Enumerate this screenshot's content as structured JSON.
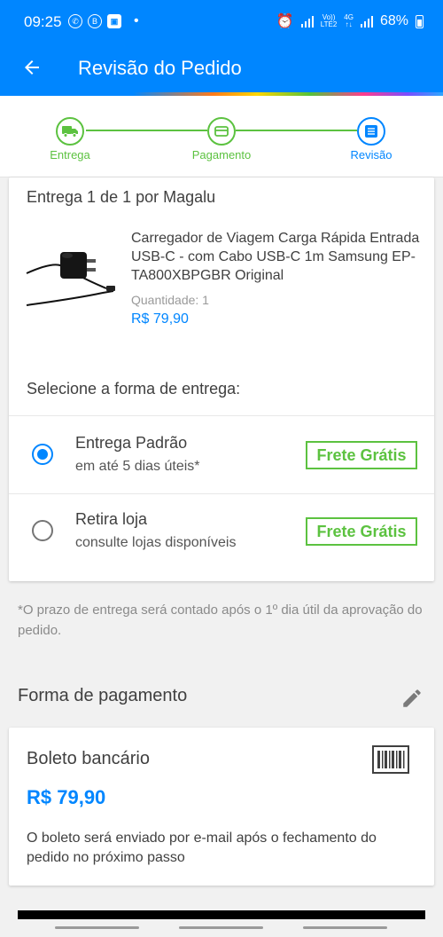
{
  "status_bar": {
    "time": "09:25",
    "network_top": "Vo))",
    "network_bottom": "LTE2",
    "net_type_top": "4G",
    "net_type_bottom": "↑↓",
    "battery": "68%"
  },
  "header": {
    "title": "Revisão do Pedido",
    "back_icon": "arrow-left-icon"
  },
  "stepper": {
    "steps": [
      {
        "label": "Entrega",
        "icon": "truck-icon",
        "state": "done"
      },
      {
        "label": "Pagamento",
        "icon": "card-icon",
        "state": "done"
      },
      {
        "label": "Revisão",
        "icon": "list-icon",
        "state": "active"
      }
    ]
  },
  "delivery": {
    "title": "Entrega 1 de 1 por Magalu",
    "product": {
      "name": "Carregador de Viagem Carga Rápida Entrada USB-C - com Cabo USB-C 1m Samsung EP-TA800XBPGBR Original",
      "quantity": "Quantidade:  1",
      "price": "R$ 79,90"
    },
    "select_title": "Selecione a forma de entrega:",
    "options": [
      {
        "title": "Entrega Padrão",
        "subtitle": "em até 5 dias úteis*",
        "badge": "Frete Grátis",
        "selected": true
      },
      {
        "title": "Retira loja",
        "subtitle": "consulte lojas disponíveis",
        "badge": "Frete Grátis",
        "selected": false
      }
    ]
  },
  "note": "*O prazo de entrega será contado após o 1º dia útil da aprovação do pedido.",
  "payment": {
    "header": "Forma de pagamento",
    "edit_icon": "pencil-icon",
    "method": "Boleto bancário",
    "method_icon": "barcode-icon",
    "price": "R$ 79,90",
    "description": "O boleto será enviado por e-mail após o fechamento do pedido no próximo passo"
  },
  "colors": {
    "primary": "#0086ff",
    "success": "#5cc240",
    "text": "#404040",
    "muted": "#8a8a8a"
  }
}
